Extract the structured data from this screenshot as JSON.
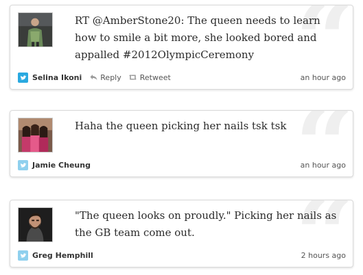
{
  "tweets": [
    {
      "author": "Selina Ikoni",
      "text": "RT @AmberStone20: The queen needs to learn how to smile a bit more, she looked bored and appalled #2012OlympicCeremony",
      "reply_label": "Reply",
      "retweet_label": "Retweet",
      "time": "an hour ago"
    },
    {
      "author": "Jamie Cheung",
      "text": "Haha the queen picking her nails tsk tsk",
      "time": "an hour ago"
    },
    {
      "author": "Greg Hemphill",
      "text": "\"The queen looks on proudly.\" Picking her nails as the GB team come out.",
      "time": "2 hours ago"
    }
  ],
  "icons": {
    "bird": "twitter-bird-icon",
    "reply": "reply-arrow-icon",
    "retweet": "retweet-icon",
    "quote": "quote-mark-icon"
  },
  "colors": {
    "twitter_blue": "#2aa9e0",
    "twitter_blue_light": "#8fd0ee",
    "quote_gray": "#efefef",
    "border": "#dadada"
  }
}
